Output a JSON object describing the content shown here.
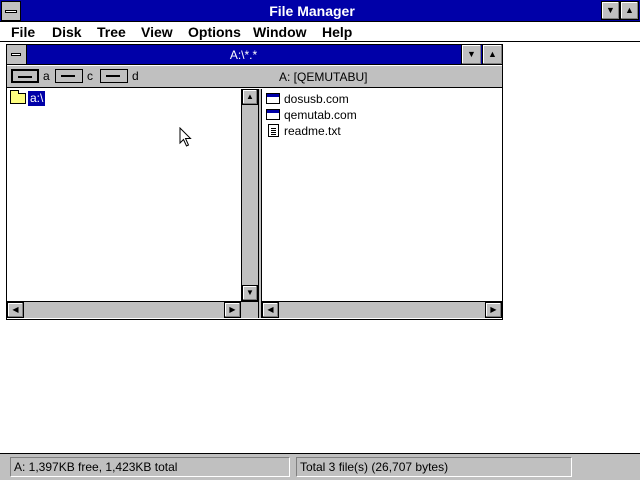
{
  "app": {
    "title": "File Manager",
    "menu": [
      "File",
      "Disk",
      "Tree",
      "View",
      "Options",
      "Window",
      "Help"
    ]
  },
  "child_window": {
    "title": "A:\\*.*",
    "drives": [
      {
        "letter": "a",
        "icon": "floppy-drive-icon",
        "selected": true
      },
      {
        "letter": "c",
        "icon": "hard-drive-icon",
        "selected": false
      },
      {
        "letter": "d",
        "icon": "cdrom-drive-icon",
        "selected": false
      }
    ],
    "volume_label": "A: [QEMUTABU]",
    "tree": {
      "items": [
        {
          "label": "a:\\",
          "icon": "open-folder-icon",
          "selected": true
        }
      ]
    },
    "files": [
      {
        "name": "dosusb.com",
        "icon": "program-icon"
      },
      {
        "name": "qemutab.com",
        "icon": "program-icon"
      },
      {
        "name": "readme.txt",
        "icon": "document-icon"
      }
    ]
  },
  "status": {
    "disk": "A: 1,397KB free,  1,423KB total",
    "files": "Total 3 file(s) (26,707 bytes)"
  },
  "colors": {
    "title_active": "#0000a8",
    "chrome": "#c0c0c0",
    "window": "#ffffff",
    "selection": "#0000a8"
  }
}
